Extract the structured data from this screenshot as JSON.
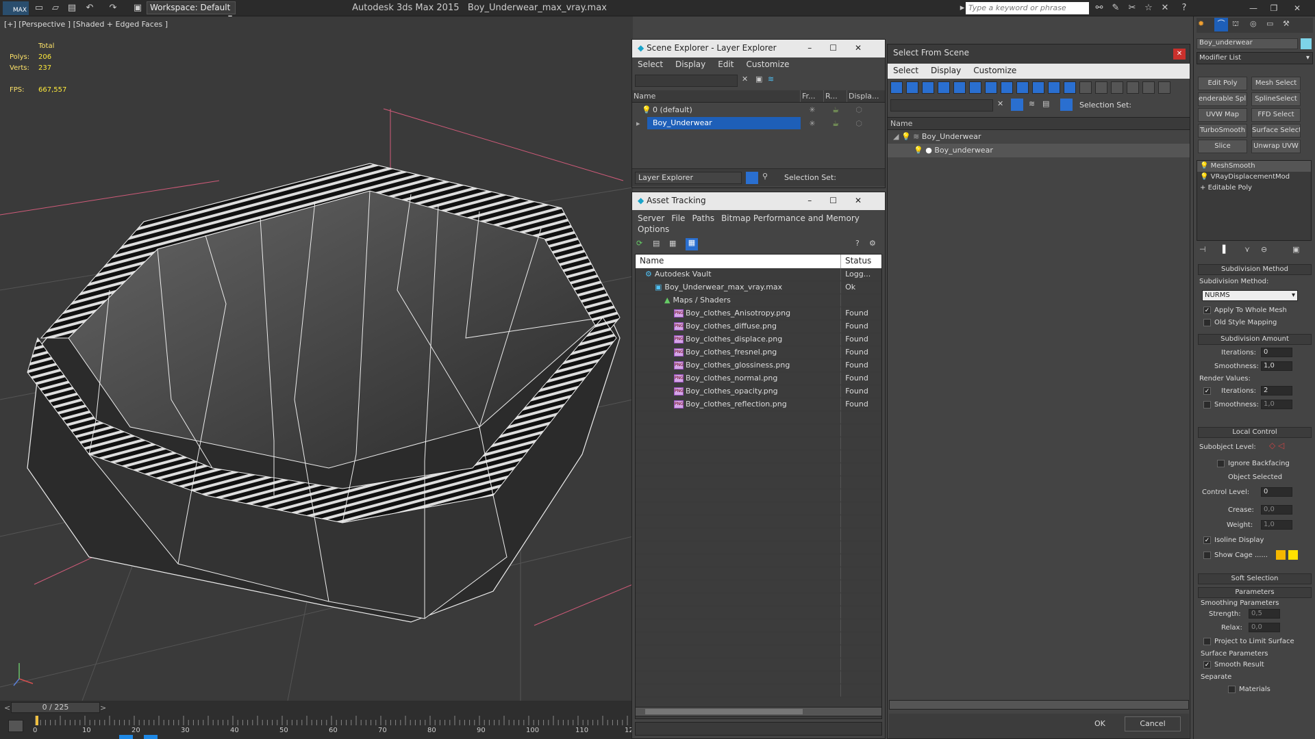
{
  "app": {
    "title": "Autodesk 3ds Max  2015",
    "file": "Boy_Underwear_max_vray.max",
    "logo": "MAX",
    "workspace": "Workspace: Default",
    "keyword_placeholder": "Type a keyword or phrase"
  },
  "viewport": {
    "label": "[+] [Perspective ] [Shaded + Edged Faces ]",
    "stats": {
      "total_label": "Total",
      "polys_label": "Polys:",
      "polys": "206",
      "verts_label": "Verts:",
      "verts": "237",
      "fps_label": "FPS:",
      "fps": "667,557"
    }
  },
  "timeline": {
    "frame": "0 / 225",
    "ticks": [
      "0",
      "10",
      "20",
      "30",
      "40",
      "50",
      "60",
      "70",
      "80",
      "90",
      "100",
      "110",
      "12"
    ]
  },
  "scene_explorer": {
    "title": "Scene Explorer - Layer Explorer",
    "menu": [
      "Select",
      "Display",
      "Edit",
      "Customize"
    ],
    "columns": [
      "Name",
      "Fr...",
      "R...",
      "Displa..."
    ],
    "rows": [
      "0 (default)",
      "Boy_Underwear"
    ],
    "footer_dropdown": "Layer Explorer",
    "selection_set": "Selection Set:"
  },
  "asset_tracking": {
    "title": "Asset Tracking",
    "menu": [
      "Server",
      "File",
      "Paths",
      "Bitmap Performance and Memory"
    ],
    "menu2": [
      "Options"
    ],
    "columns": [
      "Name",
      "Status"
    ],
    "rows": [
      {
        "name": "Autodesk Vault",
        "status": "Logg...",
        "indent": 1,
        "icon": "vault"
      },
      {
        "name": "Boy_Underwear_max_vray.max",
        "status": "Ok",
        "indent": 2,
        "icon": "max"
      },
      {
        "name": "Maps / Shaders",
        "status": "",
        "indent": 3,
        "icon": "maps"
      },
      {
        "name": "Boy_clothes_Anisotropy.png",
        "status": "Found",
        "indent": 4,
        "icon": "png"
      },
      {
        "name": "Boy_clothes_diffuse.png",
        "status": "Found",
        "indent": 4,
        "icon": "png"
      },
      {
        "name": "Boy_clothes_displace.png",
        "status": "Found",
        "indent": 4,
        "icon": "png"
      },
      {
        "name": "Boy_clothes_fresnel.png",
        "status": "Found",
        "indent": 4,
        "icon": "png"
      },
      {
        "name": "Boy_clothes_glossiness.png",
        "status": "Found",
        "indent": 4,
        "icon": "png"
      },
      {
        "name": "Boy_clothes_normal.png",
        "status": "Found",
        "indent": 4,
        "icon": "png"
      },
      {
        "name": "Boy_clothes_opacity.png",
        "status": "Found",
        "indent": 4,
        "icon": "png"
      },
      {
        "name": "Boy_clothes_reflection.png",
        "status": "Found",
        "indent": 4,
        "icon": "png"
      }
    ],
    "png_label": "PNG"
  },
  "select_from_scene": {
    "title": "Select From Scene",
    "menu": [
      "Select",
      "Display",
      "Customize"
    ],
    "selection_set": "Selection Set:",
    "column": "Name",
    "tree": [
      "Boy_Underwear",
      "Boy_underwear"
    ],
    "ok": "OK",
    "cancel": "Cancel"
  },
  "command_panel": {
    "object_name": "Boy_underwear",
    "modifier_list": "Modifier List",
    "buttons": [
      "Edit Poly",
      "Mesh Select",
      "enderable Spli",
      "SplineSelect",
      "UVW Map",
      "FFD Select",
      "TurboSmooth",
      "Surface Select",
      "Slice",
      "Unwrap UVW"
    ],
    "stack": [
      "MeshSmooth",
      "VRayDisplacementMod",
      "Editable Poly"
    ],
    "subdivision_method": {
      "rollout": "Subdivision Method",
      "label": "Subdivision Method:",
      "value": "NURMS",
      "apply_whole": "Apply To Whole Mesh",
      "old_style": "Old Style Mapping"
    },
    "subdivision_amount": {
      "rollout": "Subdivision Amount",
      "iterations_label": "Iterations:",
      "iterations": "0",
      "smoothness_label": "Smoothness:",
      "smoothness": "1,0",
      "render_values": "Render Values:",
      "r_iterations_label": "Iterations:",
      "r_iterations": "2",
      "r_smoothness_label": "Smoothness:",
      "r_smoothness": "1,0"
    },
    "local_control": {
      "rollout": "Local Control",
      "subobject": "Subobject Level:",
      "ignore_backfacing": "Ignore Backfacing",
      "object_selected": "Object Selected",
      "control_level_label": "Control Level:",
      "control_level": "0",
      "crease_label": "Crease:",
      "crease": "0,0",
      "weight_label": "Weight:",
      "weight": "1,0",
      "isoline": "Isoline Display",
      "show_cage": "Show Cage ......"
    },
    "soft_selection": "Soft Selection",
    "parameters": {
      "rollout": "Parameters",
      "smoothing": "Smoothing Parameters",
      "strength_label": "Strength:",
      "strength": "0,5",
      "relax_label": "Relax:",
      "relax": "0,0",
      "project": "Project to Limit Surface",
      "surface": "Surface Parameters",
      "smooth_result": "Smooth Result",
      "separate": "Separate",
      "materials": "Materials"
    },
    "colors": {
      "accent": "#1e5fb8",
      "cage1": "#f5b700",
      "cage2": "#ffe000"
    }
  }
}
